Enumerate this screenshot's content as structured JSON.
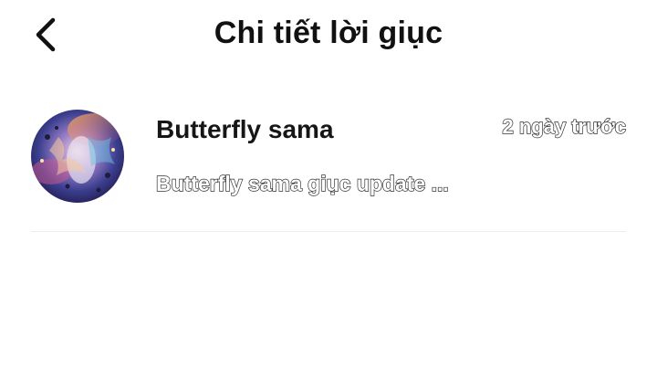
{
  "header": {
    "back_icon": "chevron-left-icon",
    "title": "Chi tiết lời giục"
  },
  "notifications": [
    {
      "avatar": "user-avatar",
      "sender": "Butterfly sama",
      "time": "2 ngày trước",
      "message": "Butterfly sama giục update ..."
    }
  ],
  "colors": {
    "background": "#ffffff",
    "text": "#111111",
    "divider": "#eeeeee"
  }
}
